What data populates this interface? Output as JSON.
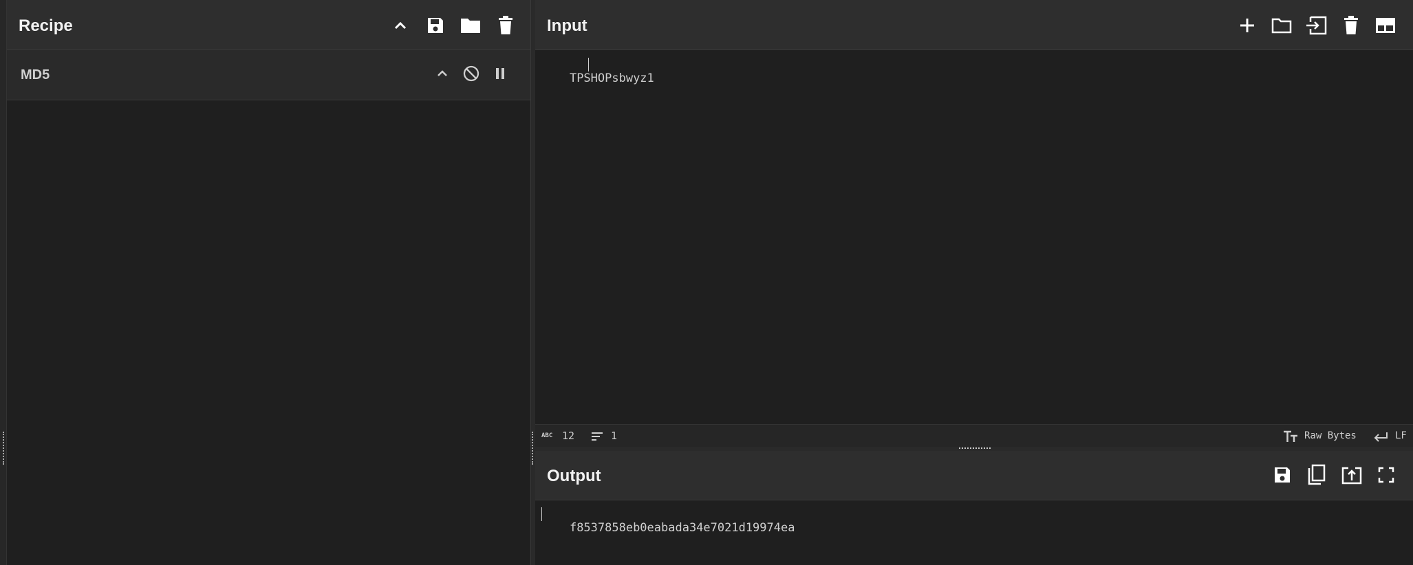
{
  "recipe": {
    "title": "Recipe",
    "operation": {
      "name": "MD5"
    }
  },
  "input": {
    "title": "Input",
    "text": "TPSHOPsbwyz1",
    "status": {
      "length": "12",
      "lines": "1",
      "encoding": "Raw Bytes",
      "eol": "LF",
      "abc_label": "ABC"
    }
  },
  "output": {
    "title": "Output",
    "text": "f8537858eb0eabada34e7021d19974ea"
  },
  "colors": {
    "background": "#1f1f1f",
    "header": "#2e2e2e",
    "text": "#dddddd",
    "icon": "#ffffff"
  }
}
